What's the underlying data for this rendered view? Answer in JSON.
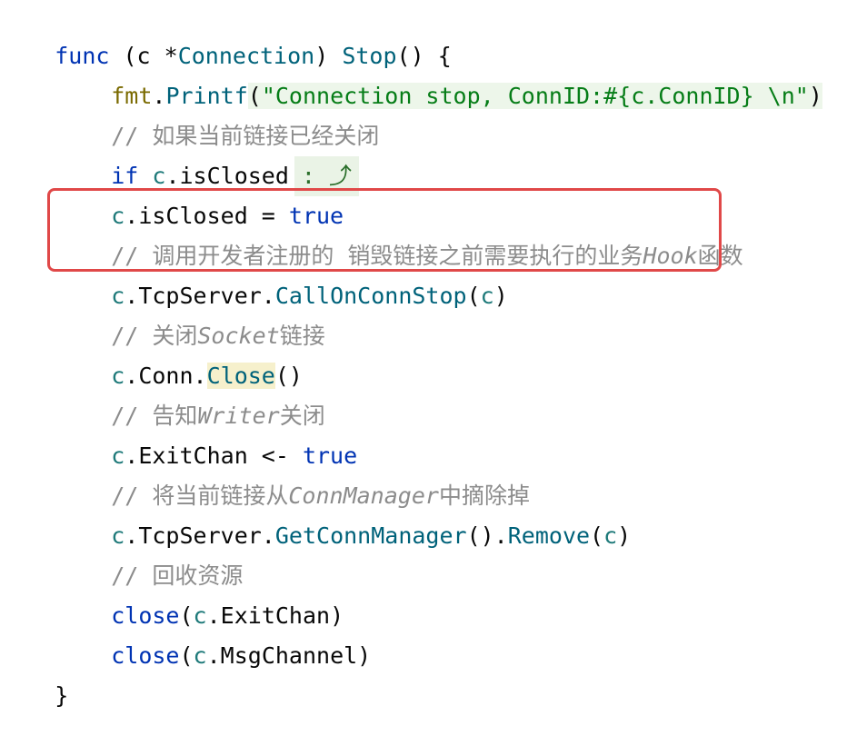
{
  "code": {
    "l1": {
      "kw": "func",
      "recv_open": " (c *",
      "type": "Connection",
      "recv_close": ") ",
      "name": "Stop",
      "rest": "() {"
    },
    "l2": {
      "pkg": "fmt",
      "dot": ".",
      "fn": "Printf",
      "open": "(",
      "str": "\"Connection stop, ConnID:#{c.ConnID} \\n\"",
      "close": ")"
    },
    "l3": {
      "comment": "// 如果当前链接已经关闭"
    },
    "l4": {
      "kw": "if",
      "recv": " c",
      "field": ".isClosed",
      "fold_text": ": ⤴"
    },
    "l5": {
      "recv": "c",
      "field": ".isClosed = ",
      "kw": "true"
    },
    "l6": {
      "comment_a": "// 调用开发者注册的 销毁链接之前需要执行的业务",
      "comment_i": "Hook",
      "comment_b": "函数"
    },
    "l7": {
      "recv": "c",
      "dot": ".TcpServer.",
      "fn": "CallOnConnStop",
      "open": "(",
      "arg": "c",
      "close": ")"
    },
    "l8": {
      "comment_a": "// 关闭",
      "comment_i": "Socket",
      "comment_b": "链接"
    },
    "l9": {
      "recv": "c",
      "dot": ".Conn.",
      "fn": "Close",
      "rest": "()"
    },
    "l10": {
      "comment_a": "// 告知",
      "comment_i": "Writer",
      "comment_b": "关闭"
    },
    "l11": {
      "recv": "c",
      "rest": ".ExitChan <- ",
      "kw": "true"
    },
    "l12": {
      "comment_a": "// 将当前链接从",
      "comment_i": "ConnManager",
      "comment_b": "中摘除掉"
    },
    "l13": {
      "recv": "c",
      "dot": ".TcpServer.",
      "fn1": "GetConnManager",
      "mid": "().",
      "fn2": "Remove",
      "open": "(",
      "arg": "c",
      "close": ")"
    },
    "l14": {
      "comment": "// 回收资源"
    },
    "l15": {
      "kw": "close",
      "open": "(",
      "recv": "c",
      "rest": ".ExitChan)"
    },
    "l16": {
      "kw": "close",
      "open": "(",
      "recv": "c",
      "rest": ".MsgChannel)"
    },
    "l17": {
      "brace": "}"
    }
  },
  "colors": {
    "keyword": "#0033b3",
    "function": "#00627a",
    "string": "#067d17",
    "comment": "#8c8c8c",
    "highlight_box": "#e04848"
  }
}
